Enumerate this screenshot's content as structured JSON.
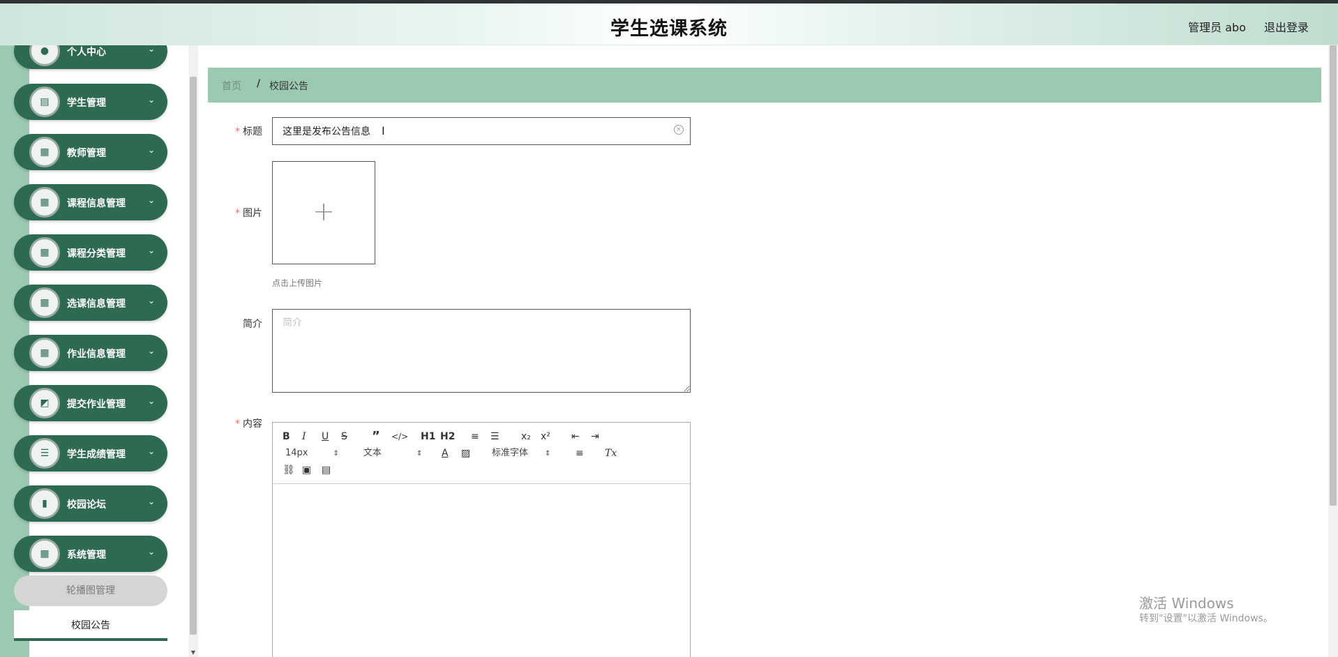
{
  "header": {
    "title": "学生选课系统",
    "user": "管理员 abo",
    "logout": "退出登录"
  },
  "sidebar": {
    "items": [
      {
        "label": "个人中心",
        "icon": "person-icon"
      },
      {
        "label": "学生管理",
        "icon": "clipboard-icon"
      },
      {
        "label": "教师管理",
        "icon": "grid-icon"
      },
      {
        "label": "课程信息管理",
        "icon": "grid-icon"
      },
      {
        "label": "课程分类管理",
        "icon": "grid-icon"
      },
      {
        "label": "选课信息管理",
        "icon": "grid-icon"
      },
      {
        "label": "作业信息管理",
        "icon": "grid-icon"
      },
      {
        "label": "提交作业管理",
        "icon": "chart-icon"
      },
      {
        "label": "学生成绩管理",
        "icon": "list-icon"
      },
      {
        "label": "校园论坛",
        "icon": "bar-chart-icon"
      },
      {
        "label": "系统管理",
        "icon": "grid-icon"
      }
    ],
    "sub_items": [
      {
        "label": "轮播图管理"
      },
      {
        "label": "校园公告"
      }
    ]
  },
  "breadcrumb": {
    "home": "首页",
    "separator": "/",
    "current": "校园公告"
  },
  "form": {
    "title_label": "标题",
    "title_value": "这里是发布公告信息",
    "image_label": "图片",
    "upload_tip": "点击上传图片",
    "brief_label": "简介",
    "brief_placeholder": "简介",
    "content_label": "内容"
  },
  "editor": {
    "font_size": "14px",
    "paragraph": "文本",
    "font_family": "标准字体",
    "h1": "H1",
    "h2": "H2",
    "sub": "x₂",
    "sup": "x²"
  },
  "watermark": {
    "line1": "激活 Windows",
    "line2": "转到\"设置\"以激活 Windows。"
  },
  "colors": {
    "primary": "#2e6a52",
    "accent_light": "#9cc9b2",
    "required": "#f56c6c"
  }
}
